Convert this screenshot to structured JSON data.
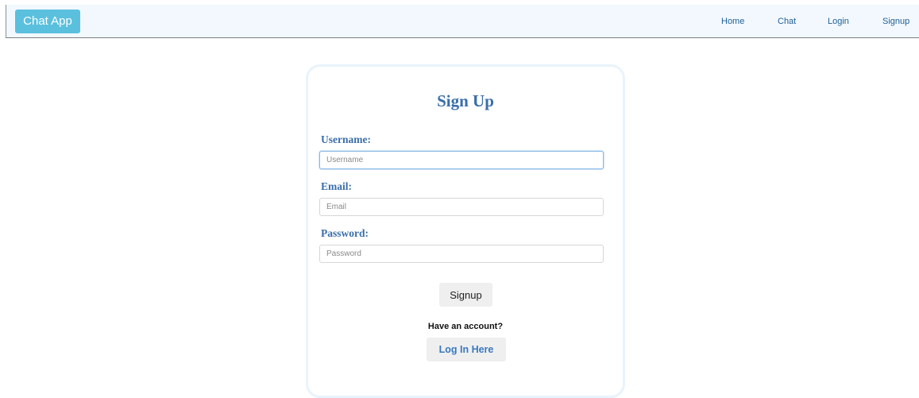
{
  "navbar": {
    "brand": "Chat App",
    "links": [
      "Home",
      "Chat",
      "Login",
      "Signup"
    ]
  },
  "form": {
    "title": "Sign Up",
    "username_label": "Username:",
    "username_placeholder": "Username",
    "email_label": "Email:",
    "email_placeholder": "Email",
    "password_label": "Password:",
    "password_placeholder": "Password",
    "submit_label": "Signup",
    "have_account_text": "Have an account?",
    "login_link_label": "Log In Here"
  },
  "colors": {
    "brand_button": "#5bc0de",
    "navbar_bg": "#f2f8fd",
    "heading": "#3a6ea9",
    "link": "#1f5f98"
  }
}
